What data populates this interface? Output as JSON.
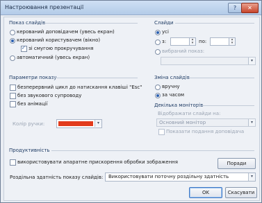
{
  "window": {
    "title": "Настроювання презентації",
    "help_label": "?",
    "close_label": "✕"
  },
  "show_type": {
    "section": "Показ слайдів",
    "options": [
      {
        "label": "керований доповідачем (увесь екран)",
        "checked": false
      },
      {
        "label": "керований користувачем (вікно)",
        "checked": true
      },
      {
        "label": "автоматичний (увесь екран)",
        "checked": false
      }
    ],
    "scrollbar_label": "зі смугою прокручування"
  },
  "show_options": {
    "section": "Параметри показу",
    "items": [
      "безперервний цикл до натискання клавіші \"Esc\"",
      "без звукового супроводу",
      "без анімації"
    ],
    "pen_color_label": "Колір ручки:",
    "pen_color": "#e23b1c"
  },
  "slides": {
    "section": "Слайди",
    "all_label": "усі",
    "from_label": "з:",
    "to_label": "по:",
    "custom_label": "вибраний показ:"
  },
  "advance": {
    "section": "Зміна слайдів",
    "manual_label": "вручну",
    "timings_label": "за часом"
  },
  "monitors": {
    "section": "Декілька моніторів",
    "display_label": "Відображати слайди на:",
    "monitor_value": "Основний монітор",
    "presenter_view_label": "Показати подання доповідача"
  },
  "performance": {
    "section": "Продуктивність",
    "hw_accel_label": "використовувати апаратне прискорення обробки зображення",
    "tips_button": "Поради",
    "resolution_label": "Роздільна здатність показу слайдів:",
    "resolution_value": "Використовувати поточну роздільну здатність"
  },
  "buttons": {
    "ok": "OK",
    "cancel": "Скасувати"
  }
}
